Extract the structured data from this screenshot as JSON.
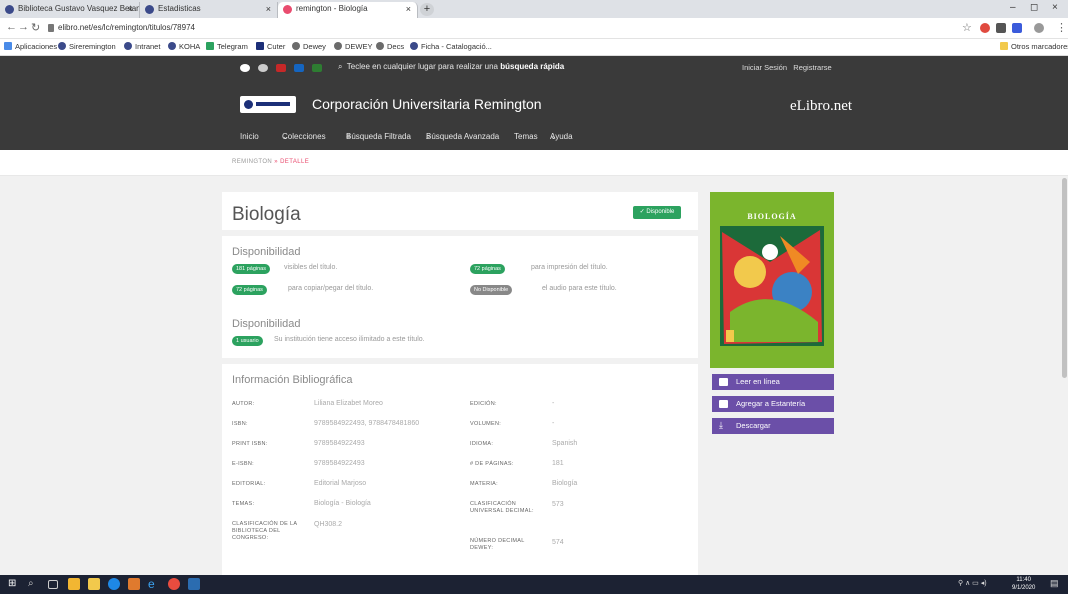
{
  "browser": {
    "tabs": [
      {
        "label": "Biblioteca Gustavo Vasquez Betan..."
      },
      {
        "label": "Estadisticas"
      },
      {
        "label": "remington - Biología"
      }
    ],
    "new_tab": "+",
    "url": "elibro.net/es/lc/remington/titulos/78974",
    "window_controls": {
      "minimize": "–",
      "maximize": "◻",
      "close": "×"
    },
    "bookmarks": [
      "Aplicaciones",
      "Sireremington",
      "Intranet",
      "KOHA",
      "Telegram",
      "Cuter",
      "Dewey",
      "DEWEY",
      "Decs",
      "Ficha - Catalogació..."
    ],
    "other_bookmarks": "Otros marcadores"
  },
  "site": {
    "search_text": "Teclee en cualquier lugar para realizar una",
    "search_bold": "búsqueda rápida",
    "login": "Iniciar Sesión",
    "register": "Registrarse",
    "university": "Corporación Universitaria Remington",
    "brand": "eLibro.net",
    "menu": [
      "Inicio",
      "Colecciones",
      "Búsqueda Filtrada",
      "Búsqueda Avanzada",
      "Temas",
      "Ayuda"
    ],
    "breadcrumb_root": "REMINGTON",
    "breadcrumb_sep": "»",
    "breadcrumb_current": "DETALLE"
  },
  "book": {
    "title": "Biología",
    "status": "✓ Disponible",
    "availability_title": "Disponibilidad",
    "pills": [
      {
        "badge": "181 páginas",
        "text": "visibles del título.",
        "color": "#2ca25f"
      },
      {
        "badge": "72 páginas",
        "text": "para impresión del título.",
        "color": "#2ca25f"
      },
      {
        "badge": "72 páginas",
        "text": "para copiar/pegar del título.",
        "color": "#2ca25f"
      },
      {
        "badge": "No Disponible",
        "text": "el audio para este título.",
        "color": "#888888"
      }
    ],
    "availability_title_2": "Disponibilidad",
    "access_badge": "1 usuario",
    "access_text": "Su institución tiene acceso ilimitado a este título.",
    "info_title": "Información Bibliográfica",
    "fields_left": [
      {
        "label": "AUTOR:",
        "value": "Liliana Elizabet Moreo"
      },
      {
        "label": "ISBN:",
        "value": "9789584922493, 9788478481860"
      },
      {
        "label": "PRINT ISBN:",
        "value": "9789584922493"
      },
      {
        "label": "E-ISBN:",
        "value": "9789584922493"
      },
      {
        "label": "EDITORIAL:",
        "value": "Editorial Marjoso"
      },
      {
        "label": "TEMAS:",
        "value": "Biología - Biología"
      },
      {
        "label": "CLASIFICACIÓN DE LA BIBLIOTECA DEL CONGRESO:",
        "value": "QH308.2"
      }
    ],
    "fields_right": [
      {
        "label": "EDICIÓN:",
        "value": "-"
      },
      {
        "label": "VOLUMEN:",
        "value": "-"
      },
      {
        "label": "IDIOMA:",
        "value": "Spanish"
      },
      {
        "label": "# DE PÁGINAS:",
        "value": "181"
      },
      {
        "label": "MATERIA:",
        "value": "Biología"
      },
      {
        "label": "CLASIFICACIÓN UNIVERSAL DECIMAL:",
        "value": "573"
      },
      {
        "label": "NÚMERO DECIMAL DEWEY:",
        "value": "574"
      }
    ],
    "cover_title": "BIOLOGÍA",
    "actions": [
      "Leer en línea",
      "Agregar a Estantería",
      "Descargar"
    ]
  },
  "taskbar": {
    "clock_time": "11:40",
    "clock_date": "9/1/2020"
  }
}
